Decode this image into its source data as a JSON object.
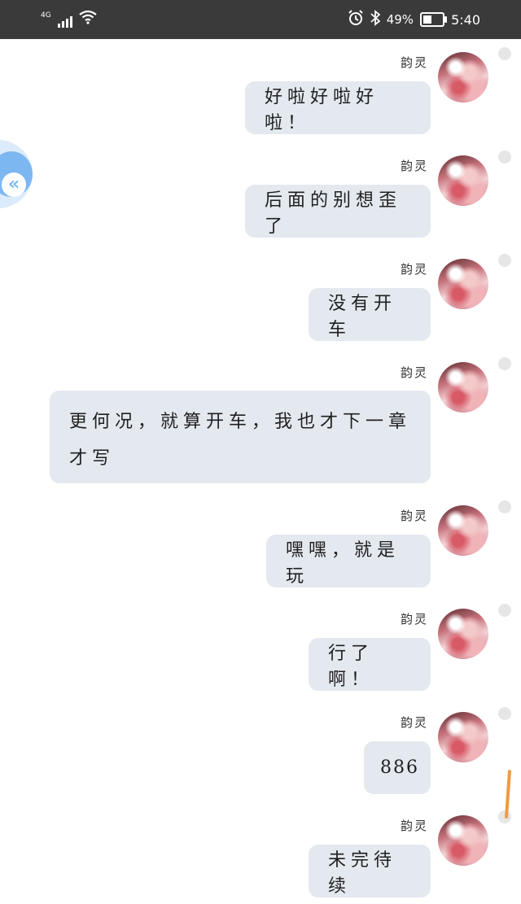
{
  "status_bar": {
    "network": "4G",
    "battery_percent": "49%",
    "time": "5:40"
  },
  "messages": [
    {
      "sender": "韵灵",
      "text": "好啦好啦好啦！"
    },
    {
      "sender": "韵灵",
      "text": "后面的别想歪了"
    },
    {
      "sender": "韵灵",
      "text": "没有开车"
    },
    {
      "sender": "韵灵",
      "text": "更何况，就算开车，我也才下一章才写"
    },
    {
      "sender": "韵灵",
      "text": "嘿嘿，就是玩"
    },
    {
      "sender": "韵灵",
      "text": "行了啊！"
    },
    {
      "sender": "韵灵",
      "text": "886"
    },
    {
      "sender": "韵灵",
      "text": "未完待续"
    }
  ],
  "colors": {
    "status_bar_bg": "#3a3a3a",
    "bubble_bg": "#e4e8ef",
    "float_button": "#7cb7f2",
    "scroll_accent": "#ef9a45"
  },
  "icons": [
    "signal-icon",
    "wifi-icon",
    "alarm-icon",
    "bluetooth-icon",
    "battery-icon",
    "back-chevron-icon"
  ]
}
